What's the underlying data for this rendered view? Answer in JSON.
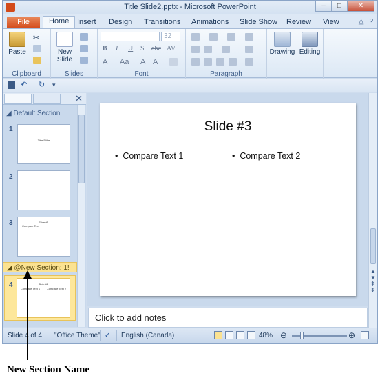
{
  "window": {
    "title": "Title Slide2.pptx - Microsoft PowerPoint",
    "buttons": [
      "–",
      "□",
      "✕"
    ]
  },
  "tabs": [
    "File",
    "Home",
    "Insert",
    "Design",
    "Transitions",
    "Animations",
    "Slide Show",
    "Review",
    "View"
  ],
  "active_tab": "Home",
  "ribbon": {
    "clipboard": {
      "paste_label": "Paste",
      "group_label": "Clipboard"
    },
    "slides": {
      "new_slide_label": "New\nSlide",
      "new_slide_line1": "New",
      "new_slide_line2": "Slide",
      "group_label": "Slides"
    },
    "font": {
      "size": "32",
      "group_label": "Font",
      "format_labels": [
        "B",
        "I",
        "U",
        "S",
        "abc",
        "AV"
      ]
    },
    "paragraph": {
      "group_label": "Paragraph"
    },
    "drawing": {
      "label": "Drawing"
    },
    "editing": {
      "label": "Editing"
    }
  },
  "left_panel": {
    "default_section": "Default Section",
    "new_section": "@New Section: 1!",
    "slides": [
      {
        "num": "1",
        "thumb_title": "Title Slide"
      },
      {
        "num": "2",
        "thumb_title": ""
      },
      {
        "num": "3",
        "thumb_title": "Slide #1",
        "thumb_text": "Compare Text"
      },
      {
        "num": "4",
        "thumb_title": "Slide #3",
        "thumb_text1": "Compare Text 1",
        "thumb_text2": "Compare Text 2"
      }
    ]
  },
  "slide": {
    "title": "Slide #3",
    "bullet1": "Compare Text 1",
    "bullet2": "Compare Text 2"
  },
  "notes_placeholder": "Click to add notes",
  "status": {
    "slide_info": "Slide 4 of 4",
    "theme": "\"Office Theme\"",
    "language": "English (Canada)",
    "zoom": "48%"
  },
  "annotation": "New Section Name",
  "colors": {
    "file_tab": "#d34a1a",
    "selection": "#fbe291",
    "ribbon_bg": "#dce8f5"
  }
}
